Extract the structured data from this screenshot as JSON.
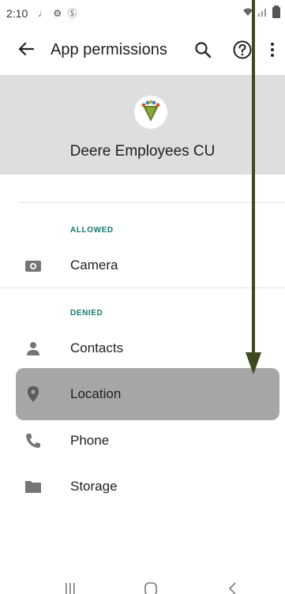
{
  "status_bar": {
    "time": "2:10",
    "notification_icons": "♩ ⚙ Ⓢ"
  },
  "app_bar": {
    "title": "App permissions"
  },
  "header": {
    "app_name": "Deere Employees CU"
  },
  "sections": {
    "allowed_label": "ALLOWED",
    "denied_label": "DENIED"
  },
  "permissions": {
    "camera": {
      "label": "Camera",
      "icon": "camera-icon"
    },
    "contacts": {
      "label": "Contacts",
      "icon": "person-icon"
    },
    "location": {
      "label": "Location",
      "icon": "location-pin-icon"
    },
    "phone": {
      "label": "Phone",
      "icon": "phone-icon"
    },
    "storage": {
      "label": "Storage",
      "icon": "folder-icon"
    }
  },
  "colors": {
    "accent": "#117a6e",
    "highlight": "#a6a6a6",
    "header_bg": "#dedede",
    "arrow": "#3c4a1e"
  }
}
